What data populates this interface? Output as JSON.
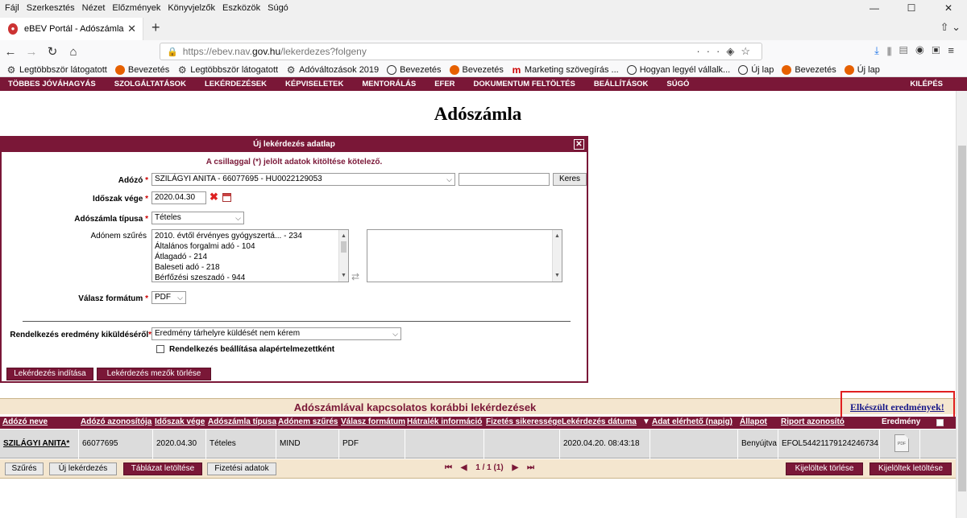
{
  "browser": {
    "menu": [
      "Fájl",
      "Szerkesztés",
      "Nézet",
      "Előzmények",
      "Könyvjelzők",
      "Eszközök",
      "Súgó"
    ],
    "tab_title": "eBEV Portál - Adószámla",
    "url_prefix": "https://ebev.nav.",
    "url_host": "gov.hu",
    "url_path": "/lekerdezes?folgeny",
    "bookmarks": [
      {
        "icon": "gear-icon",
        "label": "Legtöbbször látogatott"
      },
      {
        "icon": "firefox-icon",
        "label": "Bevezetés"
      },
      {
        "icon": "gear-icon",
        "label": "Legtöbbször látogatott"
      },
      {
        "icon": "gear-icon",
        "label": "Adóváltozások 2019"
      },
      {
        "icon": "globe-icon",
        "label": "Bevezetés"
      },
      {
        "icon": "firefox-icon",
        "label": "Bevezetés"
      },
      {
        "icon": "m-icon",
        "label": "Marketing szövegírás ..."
      },
      {
        "icon": "globe-icon",
        "label": "Hogyan legyél vállalk..."
      },
      {
        "icon": "globe-icon",
        "label": "Új lap"
      },
      {
        "icon": "firefox-icon",
        "label": "Bevezetés"
      },
      {
        "icon": "firefox-icon",
        "label": "Új lap"
      }
    ]
  },
  "sitenav": {
    "items": [
      "TÖBBES JÓVÁHAGYÁS",
      "SZOLGÁLTATÁSOK",
      "LEKÉRDEZÉSEK",
      "KÉPVISELETEK",
      "MENTORÁLÁS",
      "EFER",
      "DOKUMENTUM FELTÖLTÉS",
      "BEÁLLÍTÁSOK",
      "SÚGÓ"
    ],
    "logout": "KILÉPÉS"
  },
  "page_title": "Adószámla",
  "dialog": {
    "title": "Új lekérdezés adatlap",
    "required_note": "A csillaggal (*) jelölt adatok kitöltése kötelező.",
    "adozo_label": "Adózó",
    "adozo_value": "SZILÁGYI ANITA - 66077695 - HU0022129053",
    "search_button": "Keres",
    "idoszak_label": "Időszak vége",
    "idoszak_value": "2020.04.30",
    "tipus_label": "Adószámla típusa",
    "tipus_value": "Tételes",
    "adonem_label": "Adónem szűrés",
    "adonem_options": [
      "2010. évtől érvényes gyógyszertá... - 234",
      "Általános forgalmi adó - 104",
      "Átlagadó - 214",
      "Baleseti adó - 218",
      "Bérfőzési szeszadó - 944"
    ],
    "format_label": "Válasz formátum",
    "format_value": "PDF",
    "rendelkezes_label": "Rendelkezés eredmény kiküldéséről",
    "rendelkezes_value": "Eredmény tárhelyre küldését nem kérem",
    "default_checkbox_label": "Rendelkezés beállítása alapértelmezettként",
    "start_button": "Lekérdezés indítása",
    "clear_button": "Lekérdezés mezők törlése"
  },
  "results": {
    "title": "Adószámlával kapcsolatos korábbi lekérdezések",
    "done_link": "Elkészült eredmények!",
    "columns": [
      "Adózó neve",
      "Adózó azonosítója",
      "Időszak vége",
      "Adószámla típusa",
      "Adónem szűrés",
      "Válasz formátum",
      "Hátralék információ",
      "Fizetés sikeressége",
      "Lekérdezés dátuma",
      "Adat elérhető (napig)",
      "Állapot",
      "Riport azonosító",
      "Eredmény"
    ],
    "row": {
      "name": "SZILÁGYI ANITA*",
      "id": "66077695",
      "period": "2020.04.30",
      "type": "Tételes",
      "filter": "MIND",
      "format": "PDF",
      "arrears": "",
      "payment": "",
      "date": "2020.04.20. 08:43:18",
      "available": "",
      "status": "Benyújtva",
      "report_id": "EFOL54421179124246734"
    },
    "pdf_icon_text": "PDF",
    "buttons": {
      "filter": "Szűrés",
      "new": "Új lekérdezés",
      "download_table": "Táblázat letöltése",
      "payment_data": "Fizetési adatok",
      "delete_selected": "Kijelöltek törlése",
      "download_selected": "Kijelöltek letöltése"
    },
    "pager": "1 / 1 (1)"
  }
}
